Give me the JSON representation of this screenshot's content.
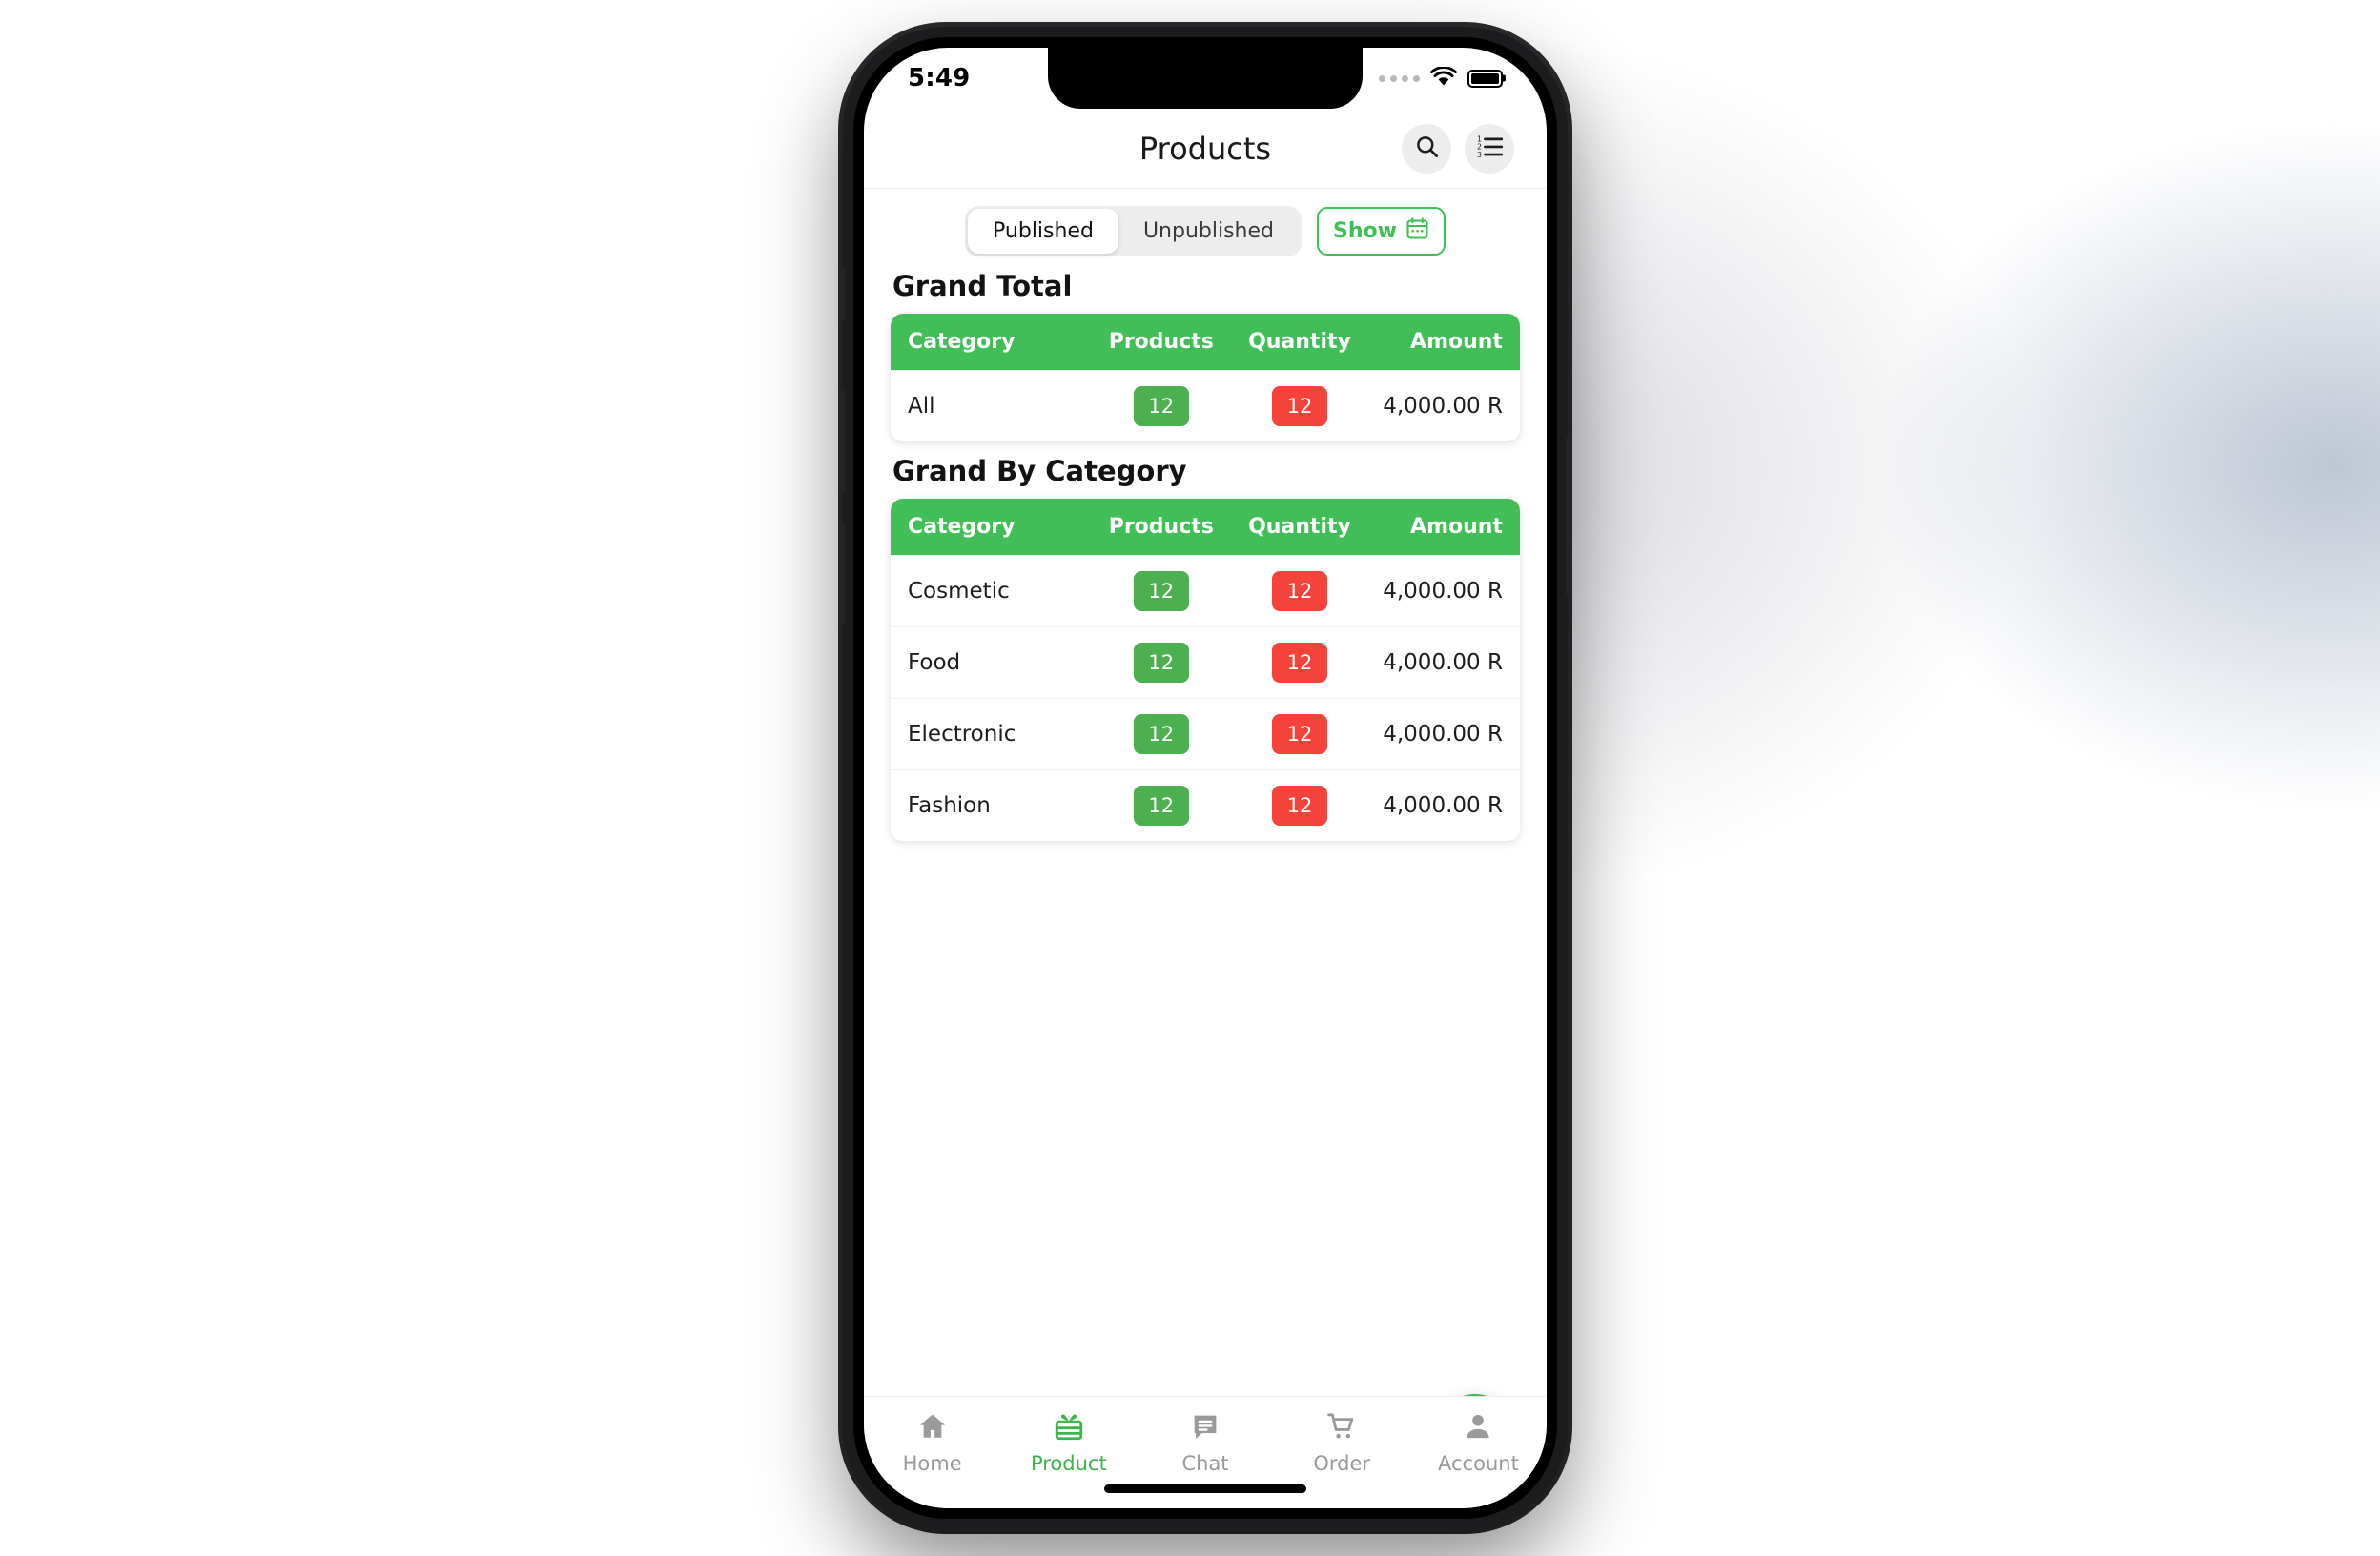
{
  "status_bar": {
    "time": "5:49",
    "signal_icon": "signal-dots-icon",
    "wifi_icon": "wifi-icon",
    "battery_icon": "battery-full-icon"
  },
  "app_bar": {
    "title": "Products",
    "search_icon": "search-icon",
    "list_icon": "numbered-list-icon"
  },
  "filters": {
    "segments": [
      {
        "label": "Published",
        "active": true
      },
      {
        "label": "Unpublished",
        "active": false
      }
    ],
    "show_button": {
      "label": "Show",
      "icon": "calendar-icon"
    }
  },
  "grand_total": {
    "title": "Grand Total",
    "columns": [
      "Category",
      "Products",
      "Quantity",
      "Amount"
    ],
    "rows": [
      {
        "category": "All",
        "products": "12",
        "quantity": "12",
        "amount": "4,000.00 R"
      }
    ]
  },
  "grand_by_category": {
    "title": "Grand By Category",
    "columns": [
      "Category",
      "Products",
      "Quantity",
      "Amount"
    ],
    "rows": [
      {
        "category": "Cosmetic",
        "products": "12",
        "quantity": "12",
        "amount": "4,000.00 R"
      },
      {
        "category": "Food",
        "products": "12",
        "quantity": "12",
        "amount": "4,000.00 R"
      },
      {
        "category": "Electronic",
        "products": "12",
        "quantity": "12",
        "amount": "4,000.00 R"
      },
      {
        "category": "Fashion",
        "products": "12",
        "quantity": "12",
        "amount": "4,000.00 R"
      }
    ]
  },
  "fab": {
    "icon": "plus-icon"
  },
  "bottom_nav": {
    "items": [
      {
        "label": "Home",
        "icon": "home-icon",
        "active": false
      },
      {
        "label": "Product",
        "icon": "gift-box-icon",
        "active": true
      },
      {
        "label": "Chat",
        "icon": "chat-icon",
        "active": false
      },
      {
        "label": "Order",
        "icon": "cart-icon",
        "active": false
      },
      {
        "label": "Account",
        "icon": "person-icon",
        "active": false
      }
    ]
  },
  "colors": {
    "brand_green": "#41be58",
    "badge_green": "#4caf50",
    "badge_red": "#f4433a",
    "accent_green": "#3cb54a"
  }
}
